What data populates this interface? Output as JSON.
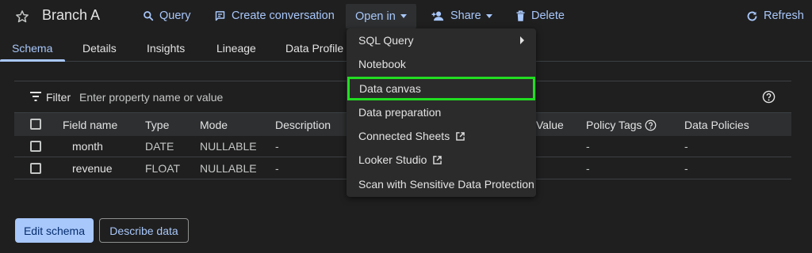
{
  "header": {
    "title": "Branch A",
    "actions": {
      "query": "Query",
      "create_conversation": "Create conversation",
      "open_in": "Open in",
      "share": "Share",
      "delete": "Delete",
      "refresh": "Refresh"
    }
  },
  "tabs": [
    "Schema",
    "Details",
    "Insights",
    "Lineage",
    "Data Profile"
  ],
  "active_tab": "Schema",
  "filter": {
    "label": "Filter",
    "placeholder": "Enter property name or value"
  },
  "table": {
    "columns": [
      "Field name",
      "Type",
      "Mode",
      "Description",
      "Value",
      "Policy Tags",
      "Data Policies"
    ],
    "rows": [
      {
        "name": "month",
        "type": "DATE",
        "mode": "NULLABLE",
        "description": "-",
        "policy_tags": "-",
        "data_policies": "-"
      },
      {
        "name": "revenue",
        "type": "FLOAT",
        "mode": "NULLABLE",
        "description": "-",
        "policy_tags": "-",
        "data_policies": "-"
      }
    ]
  },
  "buttons": {
    "edit_schema": "Edit schema",
    "describe_data": "Describe data"
  },
  "open_in_menu": {
    "items": [
      {
        "label": "SQL Query"
      },
      {
        "label": "Notebook"
      },
      {
        "label": "Data canvas"
      },
      {
        "label": "Data preparation"
      },
      {
        "label": "Connected Sheets"
      },
      {
        "label": "Looker Studio"
      },
      {
        "label": "Scan with Sensitive Data Protection"
      }
    ],
    "highlighted": "Data canvas"
  },
  "colors": {
    "background": "#1f1f1f",
    "accent": "#a8c7fa",
    "highlight_outline": "#22dd22"
  }
}
